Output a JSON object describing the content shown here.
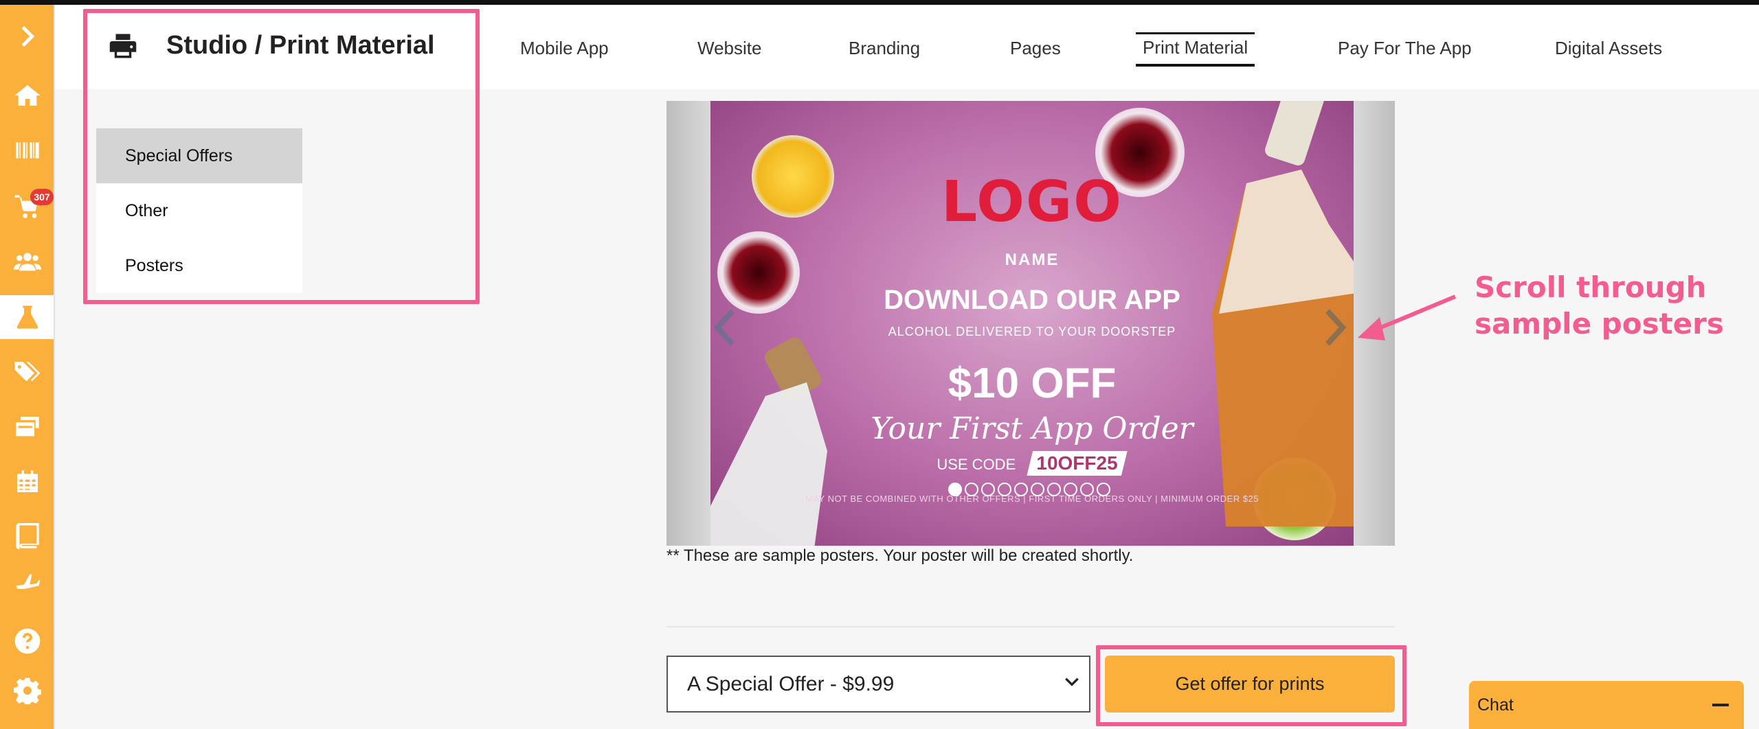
{
  "sidebar": {
    "items": [
      {
        "name": "expand-icon"
      },
      {
        "name": "home-icon"
      },
      {
        "name": "barcode-icon"
      },
      {
        "name": "cart-icon",
        "badge": "307"
      },
      {
        "name": "users-icon"
      },
      {
        "name": "flask-icon"
      },
      {
        "name": "tags-icon"
      },
      {
        "name": "cards-icon"
      },
      {
        "name": "calendar-icon"
      },
      {
        "name": "book-icon"
      },
      {
        "name": "plane-icon"
      },
      {
        "name": "help-icon"
      },
      {
        "name": "gear-icon"
      }
    ],
    "accent": "#fbb03b"
  },
  "header": {
    "title": "Studio / Print Material",
    "tabs": [
      {
        "label": "Mobile App"
      },
      {
        "label": "Website"
      },
      {
        "label": "Branding"
      },
      {
        "label": "Pages"
      },
      {
        "label": "Print Material",
        "active": true
      },
      {
        "label": "Pay For The App"
      },
      {
        "label": "Digital Assets"
      }
    ]
  },
  "categories": [
    {
      "label": "Special Offers",
      "active": true
    },
    {
      "label": "Other"
    },
    {
      "label": "Posters"
    }
  ],
  "poster": {
    "logo": "LOGO",
    "name": "NAME",
    "headline": "DOWNLOAD OUR APP",
    "subhead": "ALCOHOL DELIVERED TO YOUR DOORSTEP",
    "offer": "$10 OFF",
    "offer_sub": "Your First App Order",
    "code_label": "USE CODE",
    "code": "10OFF25",
    "fine_print": "MAY NOT BE COMBINED WITH OTHER OFFERS | FIRST TIME ORDERS ONLY | MINIMUM ORDER $25"
  },
  "carousel": {
    "slide_count": 10,
    "current_slide": 1
  },
  "caption": "** These are sample posters. Your poster will be created shortly.",
  "offer_select": {
    "value": "A Special Offer - $9.99"
  },
  "offer_button": "Get offer for prints",
  "annotation": {
    "line1": "Scroll through",
    "line2": "sample posters",
    "color": "#f25c8e"
  },
  "chat": {
    "label": "Chat"
  }
}
